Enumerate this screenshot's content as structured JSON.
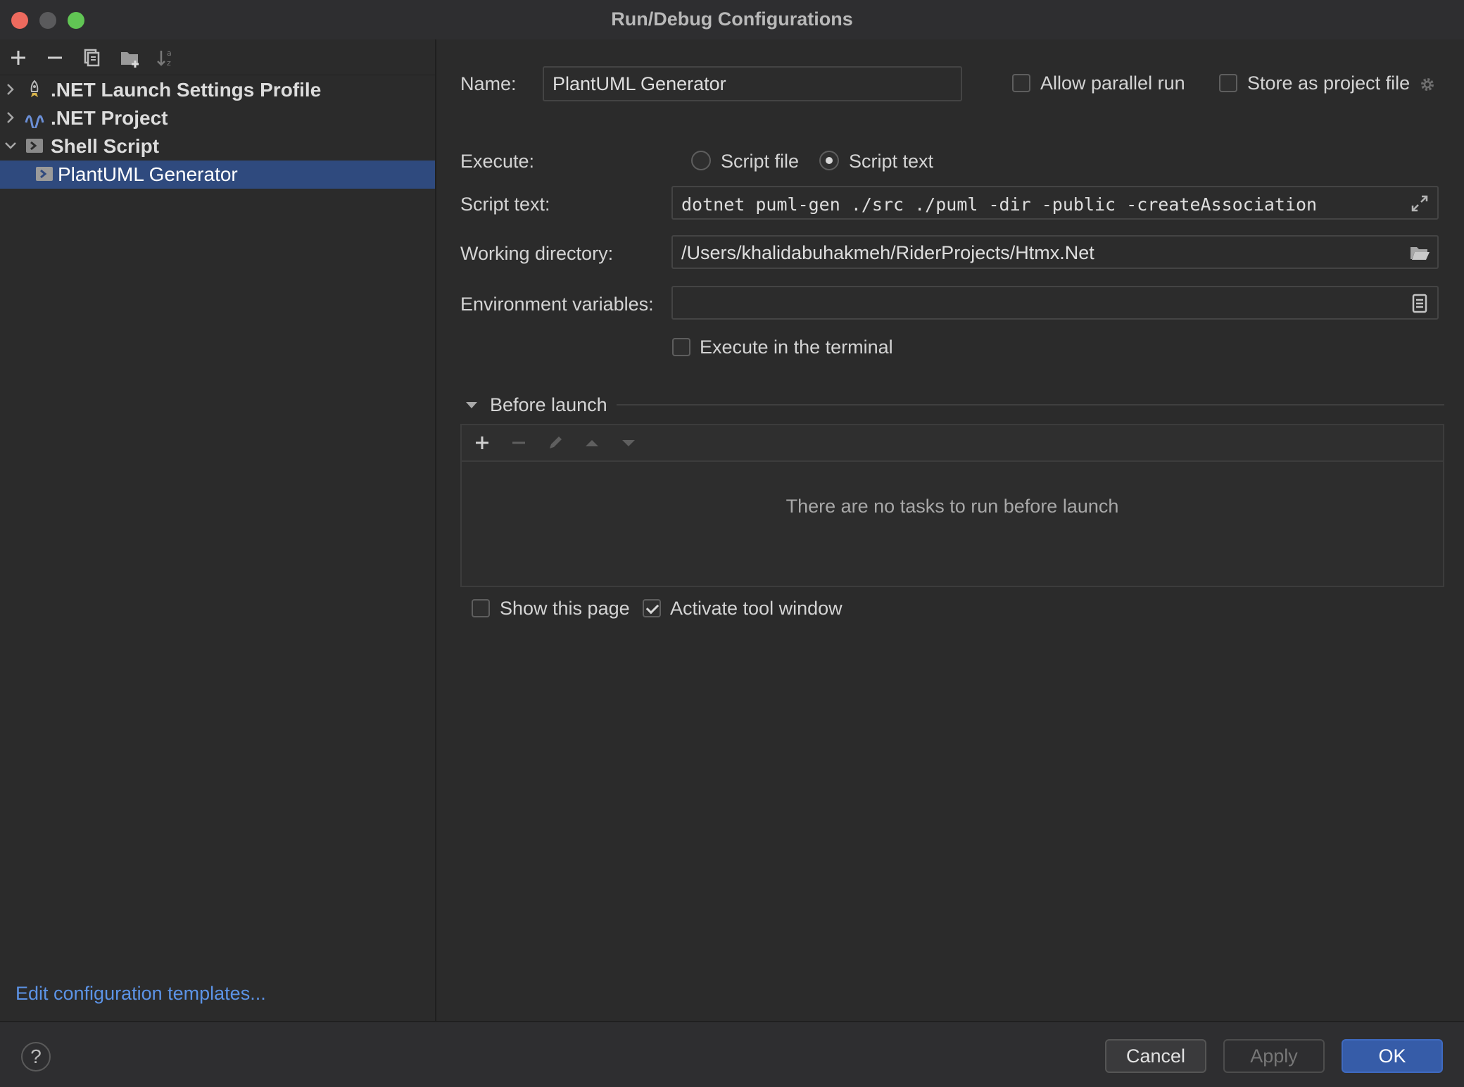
{
  "window": {
    "title": "Run/Debug Configurations"
  },
  "tree": {
    "items": [
      {
        "label": ".NET Launch Settings Profile"
      },
      {
        "label": ".NET Project"
      },
      {
        "label": "Shell Script"
      },
      {
        "label": "PlantUML Generator"
      }
    ]
  },
  "left": {
    "edit_templates": "Edit configuration templates..."
  },
  "form": {
    "name_label": "Name:",
    "name_value": "PlantUML Generator",
    "allow_parallel": "Allow parallel run",
    "store_project": "Store as project file",
    "execute_label": "Execute:",
    "script_file": "Script file",
    "script_text_option": "Script text",
    "script_text_label": "Script text:",
    "script_text_value": "dotnet puml-gen ./src ./puml -dir -public -createAssociation",
    "working_dir_label": "Working directory:",
    "working_dir_value": "/Users/khalidabuhakmeh/RiderProjects/Htmx.Net",
    "env_label": "Environment variables:",
    "env_value": "",
    "execute_terminal": "Execute in the terminal"
  },
  "before_launch": {
    "title": "Before launch",
    "empty": "There are no tasks to run before launch",
    "show_page": "Show this page",
    "activate_tool": "Activate tool window"
  },
  "footer": {
    "help": "?",
    "cancel": "Cancel",
    "apply": "Apply",
    "ok": "OK"
  },
  "colors": {
    "accent": "#365ca8",
    "selection": "#2f4a7e",
    "link": "#5c93e6"
  }
}
